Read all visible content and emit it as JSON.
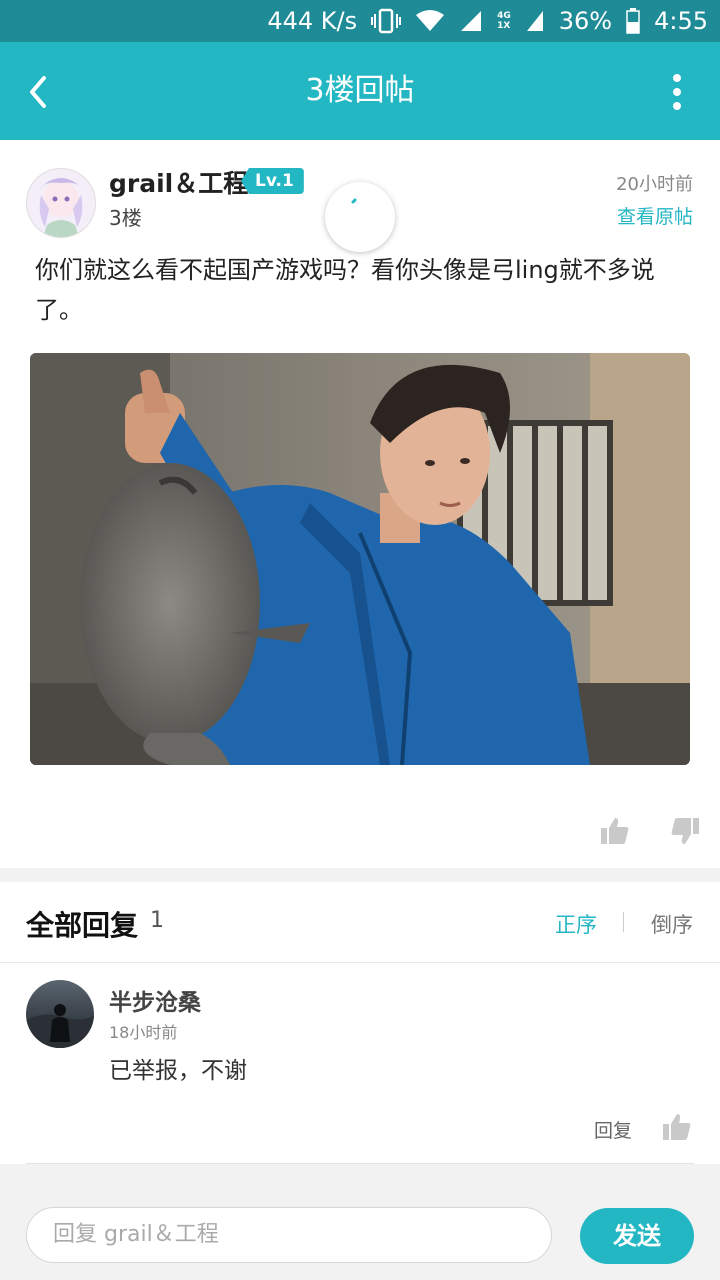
{
  "status_bar": {
    "speed": "444 K/s",
    "network_4g": "4G",
    "network_1x": "1X",
    "battery": "36%",
    "time": "4:55"
  },
  "header": {
    "title": "3楼回帖"
  },
  "post": {
    "username": "grail＆工程",
    "level": "Lv.1",
    "floor": "3楼",
    "time": "20小时前",
    "view_original": "查看原帖",
    "text": "你们就这么看不起国产游戏吗？看你头像是弓ling就不多说了。"
  },
  "replies": {
    "title": "全部回复",
    "count": "1",
    "sort_asc": "正序",
    "sort_desc": "倒序",
    "items": [
      {
        "name": "半步沧桑",
        "time": "18小时前",
        "text": "已举报，不谢",
        "reply_label": "回复"
      }
    ]
  },
  "composer": {
    "placeholder": "回复 grail＆工程",
    "send_label": "发送"
  },
  "colors": {
    "accent": "#23b6c3",
    "status_bar": "#1e8b96"
  }
}
